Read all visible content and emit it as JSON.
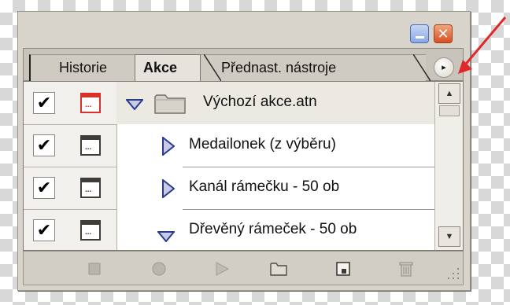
{
  "panel": {
    "window_buttons": {
      "minimize": "minimize-button",
      "close_symbol": "✕"
    }
  },
  "tabs": [
    {
      "label": "Historie",
      "active": false
    },
    {
      "label": "Akce",
      "active": true
    },
    {
      "label": "Přednast. nástroje",
      "active": false
    }
  ],
  "panel_menu_symbol": "▸",
  "actions": [
    {
      "label": "Výchozí akce.atn",
      "type": "set",
      "expanded": true,
      "checked": true,
      "dialog_on": true
    },
    {
      "label": "Medailonek (z výběru)",
      "type": "action",
      "expanded": false,
      "checked": true,
      "dialog_on": false
    },
    {
      "label": "Kanál rámečku - 50 ob",
      "type": "action",
      "expanded": false,
      "checked": true,
      "dialog_on": false
    },
    {
      "label": "Dřevěný rámeček - 50 ob",
      "type": "action",
      "expanded": true,
      "checked": true,
      "dialog_on": false
    }
  ],
  "check_symbol": "✔",
  "dialog_dots": "...",
  "scrollbar": {
    "up_symbol": "▲",
    "down_symbol": "▼"
  },
  "toolbar_icons": [
    "stop-icon",
    "record-icon",
    "play-icon",
    "new-set-icon",
    "new-action-icon",
    "trash-icon"
  ],
  "annotation": {
    "color": "#e02828"
  },
  "colors": {
    "dialog_active": "#d9302a",
    "expand_triangle": "#2e3a8c",
    "panel_bg": "#d8d4cc"
  }
}
